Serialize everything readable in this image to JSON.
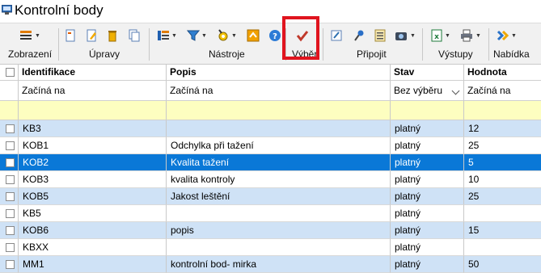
{
  "window": {
    "title": "Kontrolní body"
  },
  "ribbon": {
    "groups": {
      "view": "Zobrazení",
      "edit": "Úpravy",
      "tools": "Nástroje",
      "select": "Výběr",
      "attach": "Připojit",
      "output": "Výstupy",
      "offer": "Nabídka"
    }
  },
  "grid": {
    "columns": [
      "Identifikace",
      "Popis",
      "Stav",
      "Hodnota"
    ],
    "filters": [
      "Začíná na",
      "Začíná na",
      "Bez výběru",
      "Začíná na"
    ],
    "rows": [
      {
        "id": "KB3",
        "desc": "",
        "state": "platný",
        "value": "12"
      },
      {
        "id": "KOB1",
        "desc": "Odchylka při tažení",
        "state": "platný",
        "value": "25"
      },
      {
        "id": "KOB2",
        "desc": "Kvalita tažení",
        "state": "platný",
        "value": "5"
      },
      {
        "id": "KOB3",
        "desc": "kvalita kontroly",
        "state": "platný",
        "value": "10"
      },
      {
        "id": "KOB5",
        "desc": "Jakost leštění",
        "state": "platný",
        "value": "25"
      },
      {
        "id": "KB5",
        "desc": "",
        "state": "platný",
        "value": ""
      },
      {
        "id": "KOB6",
        "desc": "popis",
        "state": "platný",
        "value": "15"
      },
      {
        "id": "KBXX",
        "desc": "",
        "state": "platný",
        "value": ""
      },
      {
        "id": "MM1",
        "desc": "kontrolní bod- mirka",
        "state": "platný",
        "value": "50"
      }
    ],
    "selected_row": 2
  },
  "colors": {
    "row_even": "#cfe2f6",
    "row_odd": "#ffffff",
    "row_selected": "#0a78d7",
    "filter_new_row": "#fdfec0",
    "highlight_box": "#e0141e"
  },
  "icons": {
    "app": "database-icon",
    "view": "view-list-icon",
    "new": "new-record-icon",
    "edit": "edit-record-icon",
    "delete": "delete-icon",
    "copy": "copy-icon",
    "columns": "columns-icon",
    "filter": "filter-icon",
    "settings": "settings-icon",
    "sync": "sync-icon",
    "help": "help-icon",
    "select": "checkmark-icon",
    "note": "note-icon",
    "pin": "pin-icon",
    "list": "list-icon",
    "camera": "camera-icon",
    "excel": "excel-icon",
    "print": "print-icon",
    "menu": "chevron-menu-icon"
  }
}
